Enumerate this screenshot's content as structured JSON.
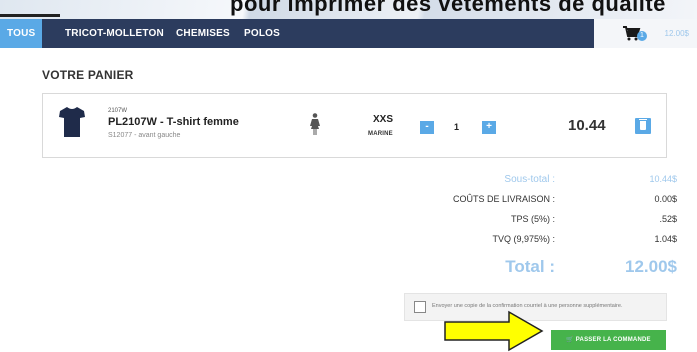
{
  "banner": {
    "caption": "pour imprimer des vêtements de qualité"
  },
  "nav": {
    "tabs": [
      {
        "label": "TOUS",
        "active": true
      },
      {
        "label": "TRICOT-MOLLETON",
        "active": false
      },
      {
        "label": "CHEMISES",
        "active": false
      },
      {
        "label": "POLOS",
        "active": false
      }
    ],
    "cart": {
      "icon": "cart-icon",
      "badge": "1",
      "total": "12.00$"
    }
  },
  "panier": {
    "title": "VOTRE PANIER"
  },
  "item": {
    "code": "2107W",
    "name": "PL2107W - T-shirt femme",
    "sub": "S12077 - avant gauche",
    "gender_icon": "female-figure-icon",
    "size": "XXS",
    "color": "MARINE",
    "minus_label": "-",
    "qty": "1",
    "plus_label": "+",
    "price": "10.44",
    "delete_icon": "trash-icon"
  },
  "totals": {
    "sous_total_label": "Sous-total :",
    "sous_total_value": "10.44$",
    "livraison_label": "COÛTS DE LIVRAISON :",
    "livraison_value": "0.00$",
    "tps_label": "TPS (5%) :",
    "tps_value": ".52$",
    "tvq_label": "TVQ (9,975%) :",
    "tvq_value": "1.04$",
    "total_label": "Total :",
    "total_value": "12.00$"
  },
  "copy_option": {
    "checked": false,
    "text": "Envoyer une copie de la confirmation courriel à une personne supplémentaire."
  },
  "submit": {
    "label": "PASSER LA COMMANDE",
    "icon": "cart-icon"
  },
  "colors": {
    "nav_bg": "#2c3c5e",
    "accent": "#5aa9e6",
    "light_accent": "#9fc8ec",
    "submit_bg": "#46b34b",
    "arrow": "#ffff00"
  }
}
